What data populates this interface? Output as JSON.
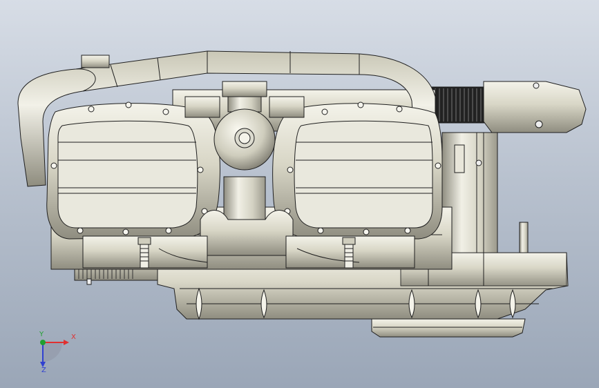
{
  "viewport": {
    "background_top": "#d7dde6",
    "background_bottom": "#9aa6b7"
  },
  "model": {
    "metal_color": "#d8d6c8",
    "edge_color": "#1e1e1e"
  },
  "triad": {
    "x_label": "X",
    "y_label": "Y",
    "z_label": "Z",
    "x_color": "#e03030",
    "y_color": "#20a030",
    "z_color": "#3040d0"
  }
}
